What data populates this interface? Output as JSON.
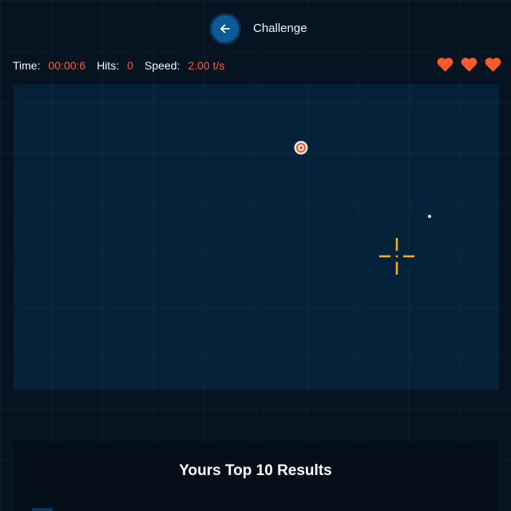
{
  "header": {
    "title": "Challenge",
    "back_icon": "arrow-left-icon"
  },
  "stats": {
    "time_label": "Time:",
    "time_value": "00:00:6",
    "hits_label": "Hits:",
    "hits_value": "0",
    "speed_label": "Speed:",
    "speed_value": "2.00 t/s"
  },
  "lives": {
    "count": 3,
    "icon": "heart-icon"
  },
  "board": {
    "target_icon": "bullseye-icon",
    "crosshair_icon": "crosshair-icon"
  },
  "results": {
    "title": "Yours Top 10 Results"
  },
  "colors": {
    "background": "#051420",
    "board": "#04223a",
    "accent_orange": "#ff5a2a",
    "crosshair_yellow": "#f5b51b",
    "back_button": "#0a5a96"
  }
}
